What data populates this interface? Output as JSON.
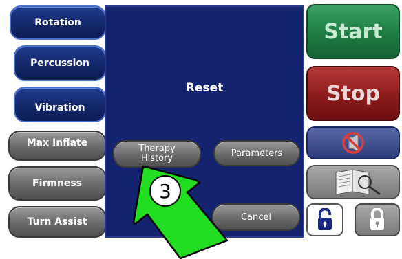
{
  "left_menu": {
    "rotation": "Rotation",
    "percussion": "Percussion",
    "vibration": "Vibration",
    "max_inflate": "Max Inflate",
    "firmness": "Firmness",
    "turn_assist": "Turn Assist"
  },
  "dialog": {
    "title": "Reset",
    "therapy_history": "Therapy History",
    "parameters": "Parameters",
    "cancel": "Cancel"
  },
  "right_panel": {
    "start": "Start",
    "stop": "Stop",
    "mute_icon": "alarm-silence-icon",
    "manual_icon": "manual-magnifier-icon",
    "unlock_icon": "unlock-icon",
    "lock_icon": "lock-icon"
  },
  "annotation": {
    "step": "3"
  },
  "colors": {
    "blue_button": "#14286c",
    "gray_button": "#6a6a6a",
    "dialog_bg": "#14236e",
    "start_green": "#1f7c44",
    "stop_red": "#8c1c1c",
    "arrow_green": "#22dd22"
  }
}
